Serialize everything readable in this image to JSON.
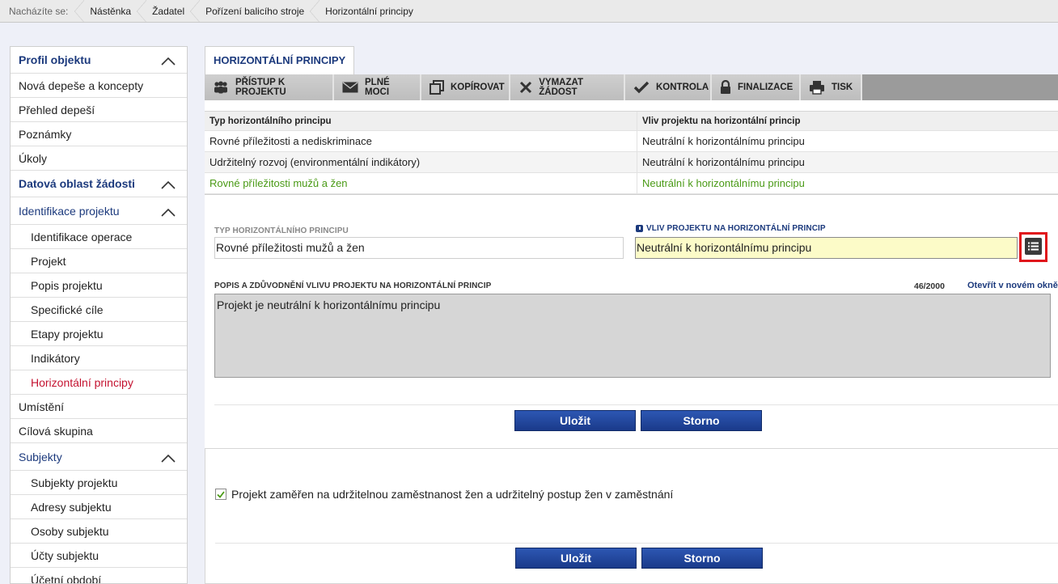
{
  "breadcrumb": {
    "label": "Nacházíte se:",
    "items": [
      "Nástěnka",
      "Žadatel",
      "Pořízení balicího stroje",
      "Horizontální principy"
    ]
  },
  "sidebar": {
    "profil": "Profil objektu",
    "items_a": [
      "Nová depeše a koncepty",
      "Přehled depeší",
      "Poznámky",
      "Úkoly"
    ],
    "datova": "Datová oblast žádosti",
    "identifikace": "Identifikace projektu",
    "items_b": [
      "Identifikace operace",
      "Projekt",
      "Popis projektu",
      "Specifické cíle",
      "Etapy projektu",
      "Indikátory",
      "Horizontální principy"
    ],
    "items_c": [
      "Umístění",
      "Cílová skupina"
    ],
    "subjekty": "Subjekty",
    "items_d": [
      "Subjekty projektu",
      "Adresy subjektu",
      "Osoby subjektu",
      "Účty subjektu",
      "Účetní období"
    ]
  },
  "tab": {
    "label": "HORIZONTÁLNÍ PRINCIPY"
  },
  "toolbar": {
    "pristup": "PŘÍSTUP K PROJEKTU",
    "plne_moci": "PLNÉ MOCI",
    "kopirovat": "KOPÍROVAT",
    "vymazat": "VYMAZAT ŽÁDOST",
    "kontrola": "KONTROLA",
    "finalizace": "FINALIZACE",
    "tisk": "TISK"
  },
  "grid": {
    "headers": [
      "Typ horizontálního principu",
      "Vliv projektu na horizontální princip"
    ],
    "rows": [
      [
        "Rovné příležitosti a nediskriminace",
        "Neutrální k horizontálnímu principu"
      ],
      [
        "Udržitelný rozvoj (environmentální indikátory)",
        "Neutrální k horizontálnímu principu"
      ],
      [
        "Rovné příležitosti mužů a žen",
        "Neutrální k horizontálnímu principu"
      ]
    ]
  },
  "form": {
    "typ_label": "TYP HORIZONTÁLNÍHO PRINCIPU",
    "typ_value": "Rovné příležitosti mužů a žen",
    "vliv_label": "VLIV PROJEKTU NA HORIZONTÁLNÍ PRINCIP",
    "vliv_value": "Neutrální k horizontálnímu principu",
    "popis_label": "POPIS A ZDŮVODNĚNÍ VLIVU PROJEKTU NA HORIZONTÁLNÍ PRINCIP",
    "counter": "46/2000",
    "open_link": "Otevřít v novém okně",
    "popis_value": "Projekt je neutrální k horizontálnímu principu",
    "save": "Uložit",
    "cancel": "Storno"
  },
  "panel2": {
    "checkbox_label": "Projekt zaměřen na udržitelnou zaměstnanost žen a udržitelný postup žen v zaměstnání",
    "checked": true,
    "save": "Uložit",
    "cancel": "Storno"
  },
  "colors": {
    "navy": "#1c3a7d",
    "active_red": "#c41230",
    "selected_green": "#4a9a16",
    "highlight_red": "#e0151b",
    "field_yellow": "#fcfbc8"
  }
}
